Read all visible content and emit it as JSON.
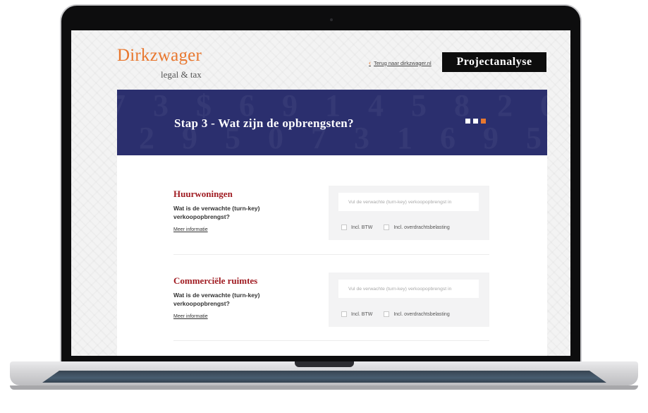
{
  "header": {
    "logo_main": "Dirkzwager",
    "logo_sub": "legal & tax",
    "back_link": "Terug naar dirkzwager.nl",
    "title_button": "Projectanalyse"
  },
  "banner": {
    "title": "Stap 3 - Wat zijn de opbrengsten?",
    "steps_total": 3,
    "active_step": 3
  },
  "sections": [
    {
      "title": "Huurwoningen",
      "question": "Wat is de verwachte (turn-key) verkoopopbrengst?",
      "more": "Meer informatie",
      "input_placeholder": "Vul de verwachte (turn-key) verkoopopbrengst in",
      "check_btw": "Incl. BTW",
      "check_overdracht": "Incl. overdrachtsbelasting"
    },
    {
      "title": "Commerciële ruimtes",
      "question": "Wat is de verwachte (turn-key) verkoopopbrengst?",
      "more": "Meer informatie",
      "input_placeholder": "Vul de verwachte (turn-key) verkoopopbrengst in",
      "check_btw": "Incl. BTW",
      "check_overdracht": "Incl. overdrachtsbelasting"
    }
  ],
  "colors": {
    "brand_orange": "#e8772e",
    "banner_navy": "#2b2f6e",
    "section_red": "#a01c22"
  }
}
